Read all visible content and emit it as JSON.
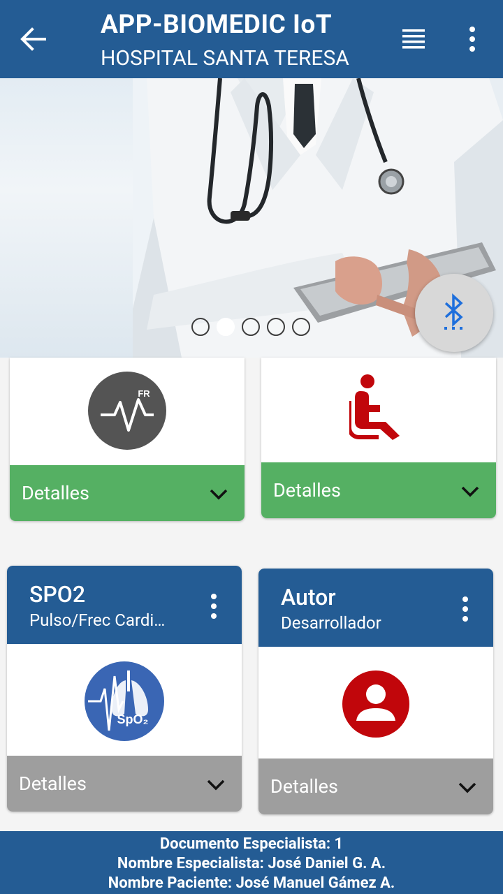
{
  "appbar": {
    "title": "APP-BIOMEDIC IoT",
    "subtitle": "HOSPITAL SANTA TERESA",
    "back_icon": "arrow-left-icon",
    "list_icon": "list-icon",
    "more_icon": "more-vert-icon"
  },
  "carousel": {
    "page_count": 5,
    "active_index": 1
  },
  "bluetooth_fab": {
    "icon": "bluetooth-searching-icon"
  },
  "cards": [
    {
      "icon": "fr-pulse-icon",
      "icon_text": "FR",
      "footer_label": "Detalles",
      "footer_color": "#55b063"
    },
    {
      "icon": "seated-person-icon",
      "footer_label": "Detalles",
      "footer_color": "#55b063"
    },
    {
      "title": "SPO2",
      "subtitle": "Pulso/Frec Cardi…",
      "icon": "spo2-lungs-icon",
      "icon_text": "SpO₂",
      "footer_label": "Detalles",
      "footer_color": "#9e9e9e"
    },
    {
      "title": "Autor",
      "subtitle": "Desarrollador",
      "icon": "user-circle-icon",
      "footer_label": "Detalles",
      "footer_color": "#9e9e9e"
    }
  ],
  "footer": {
    "line1": "Documento Especialista: 1",
    "line2": "Nombre Especialista: José Daniel G. A.",
    "line3": "Nombre Paciente: José Manuel Gámez A."
  },
  "colors": {
    "primary": "#245c94",
    "green": "#55b063",
    "grey": "#9e9e9e",
    "red": "#c1060b"
  }
}
